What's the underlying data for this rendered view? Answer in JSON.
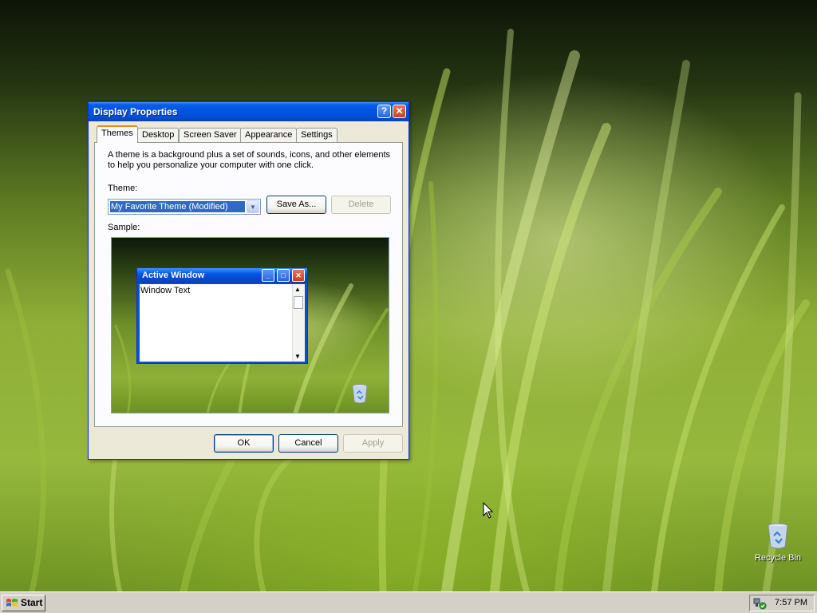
{
  "dialog": {
    "title": "Display Properties",
    "help_glyph": "?",
    "close_glyph": "✕",
    "tabs": [
      "Themes",
      "Desktop",
      "Screen Saver",
      "Appearance",
      "Settings"
    ],
    "active_tab": "Themes",
    "description": "A theme is a background plus a set of sounds, icons, and other elements to help you personalize your computer with one click.",
    "theme_label": "Theme:",
    "theme_value": "My Favorite Theme (Modified)",
    "save_as_label": "Save As...",
    "delete_label": "Delete",
    "sample_label": "Sample:",
    "sample": {
      "window_title": "Active Window",
      "window_text": "Window Text"
    },
    "ok_label": "OK",
    "cancel_label": "Cancel",
    "apply_label": "Apply"
  },
  "desktop": {
    "icons": [
      {
        "label": "Recycle Bin",
        "icon": "recycle-bin-icon"
      }
    ]
  },
  "taskbar": {
    "start_label": "Start",
    "clock": "7:57 PM",
    "tray_icons": [
      "network-connection-icon"
    ]
  },
  "colors": {
    "titlebar_blue": "#0054e3",
    "dialog_face": "#ece9d8",
    "selection_blue": "#316ac5",
    "taskbar_gray": "#d4d0c8"
  }
}
